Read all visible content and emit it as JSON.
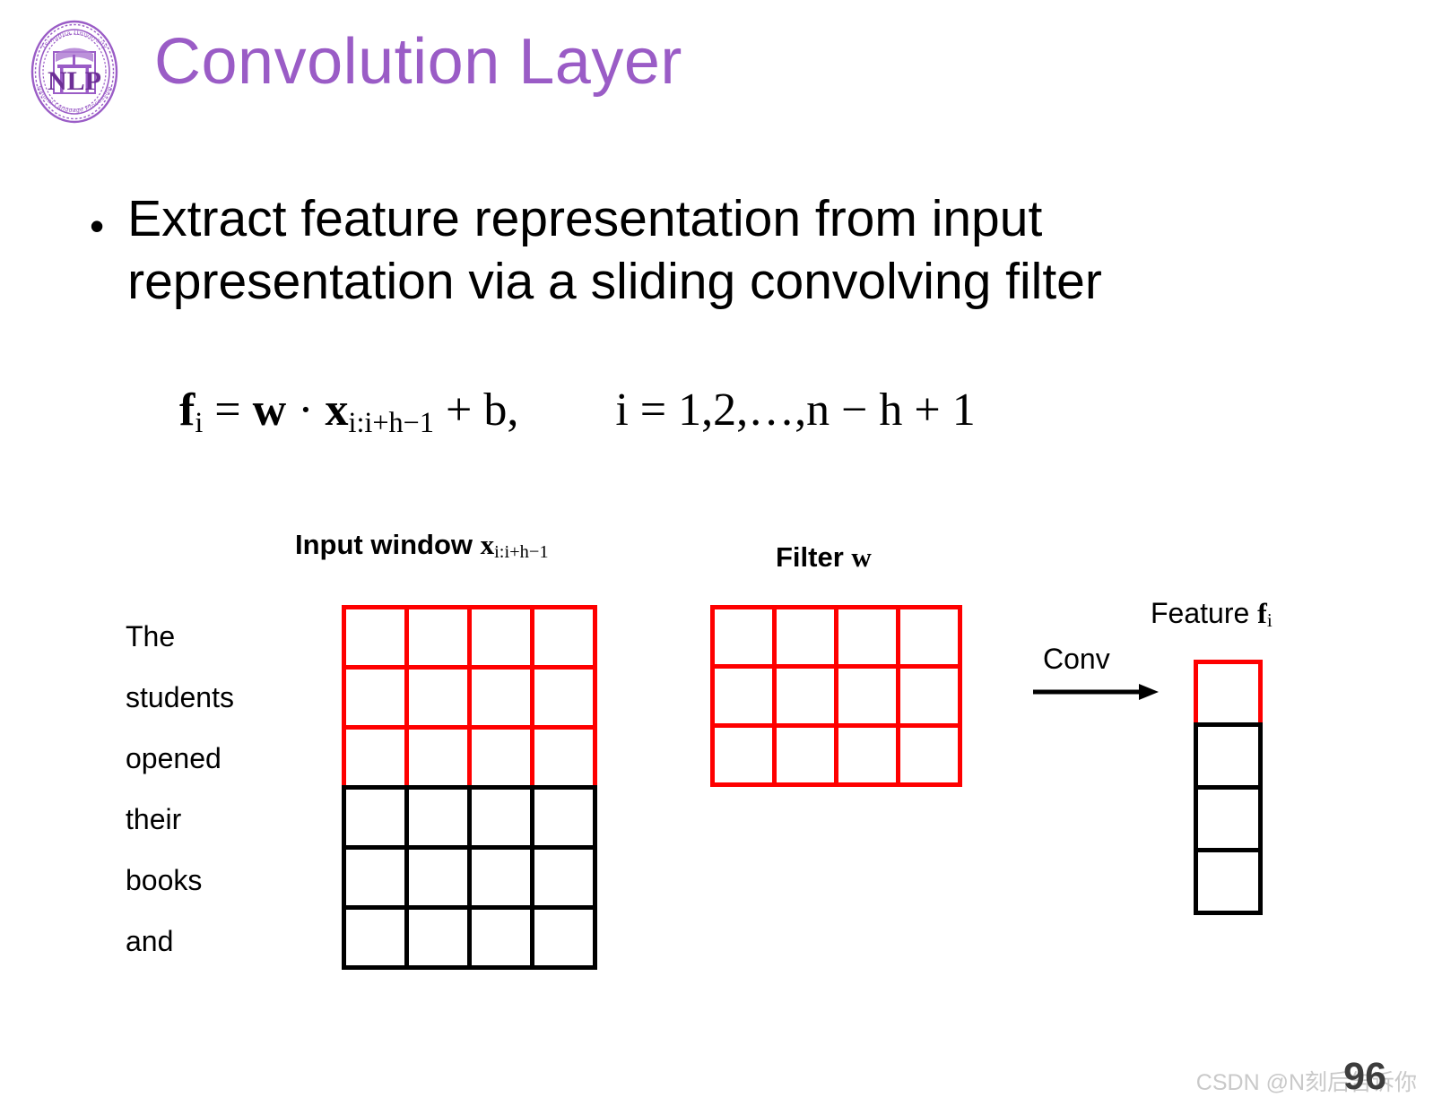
{
  "slide": {
    "title": "Convolution Layer",
    "title_color": "#9a5cc6",
    "background": "#ffffff",
    "page_number": "96",
    "watermark": "CSDN @N刻后告诉你"
  },
  "logo": {
    "name": "tsinghua-nlp-seal",
    "top_text": "Tsinghua University",
    "center_text": "NLP",
    "bottom_text": "Natural Language Processing",
    "color": "#9a5cc6"
  },
  "bullet": {
    "marker": "•",
    "text": "Extract feature representation from input representation via a sliding convolving filter"
  },
  "formula": {
    "left": {
      "lhs_symbol": "f",
      "lhs_sub": "i",
      "eq": "=",
      "w": "w",
      "dot": "·",
      "x": "x",
      "x_sub": "i:i+h−1",
      "plus": "+",
      "b": "b,",
      "plain": "f_i = w · x_{i:i+h−1} + b,"
    },
    "right": {
      "index": "i",
      "eq": "=",
      "values": "1,2,…,n − h + 1",
      "plain": "i = 1,2,…,n − h + 1"
    }
  },
  "diagram": {
    "input_label_prefix": "Input window ",
    "input_label_symbol": "x",
    "input_label_sub": "i:i+h−1",
    "filter_label_prefix": "Filter ",
    "filter_label_symbol": "w",
    "conv_label": "Conv",
    "feature_label_prefix": "Feature ",
    "feature_label_symbol": "f",
    "feature_label_sub": "i",
    "words": [
      "The",
      "students",
      "opened",
      "their",
      "books",
      "and"
    ],
    "input_grid": {
      "rows": 6,
      "cols": 4,
      "highlight_rows": 3,
      "highlight_color": "#fe0000",
      "normal_color": "#000000"
    },
    "filter_grid": {
      "rows": 3,
      "cols": 4,
      "highlight_rows": 3,
      "highlight_color": "#fe0000",
      "normal_color": "#000000"
    },
    "feature_grid": {
      "rows": 4,
      "cols": 1,
      "highlight_rows": 1,
      "highlight_color": "#fe0000",
      "normal_color": "#000000"
    },
    "arrow_direction": "right"
  }
}
